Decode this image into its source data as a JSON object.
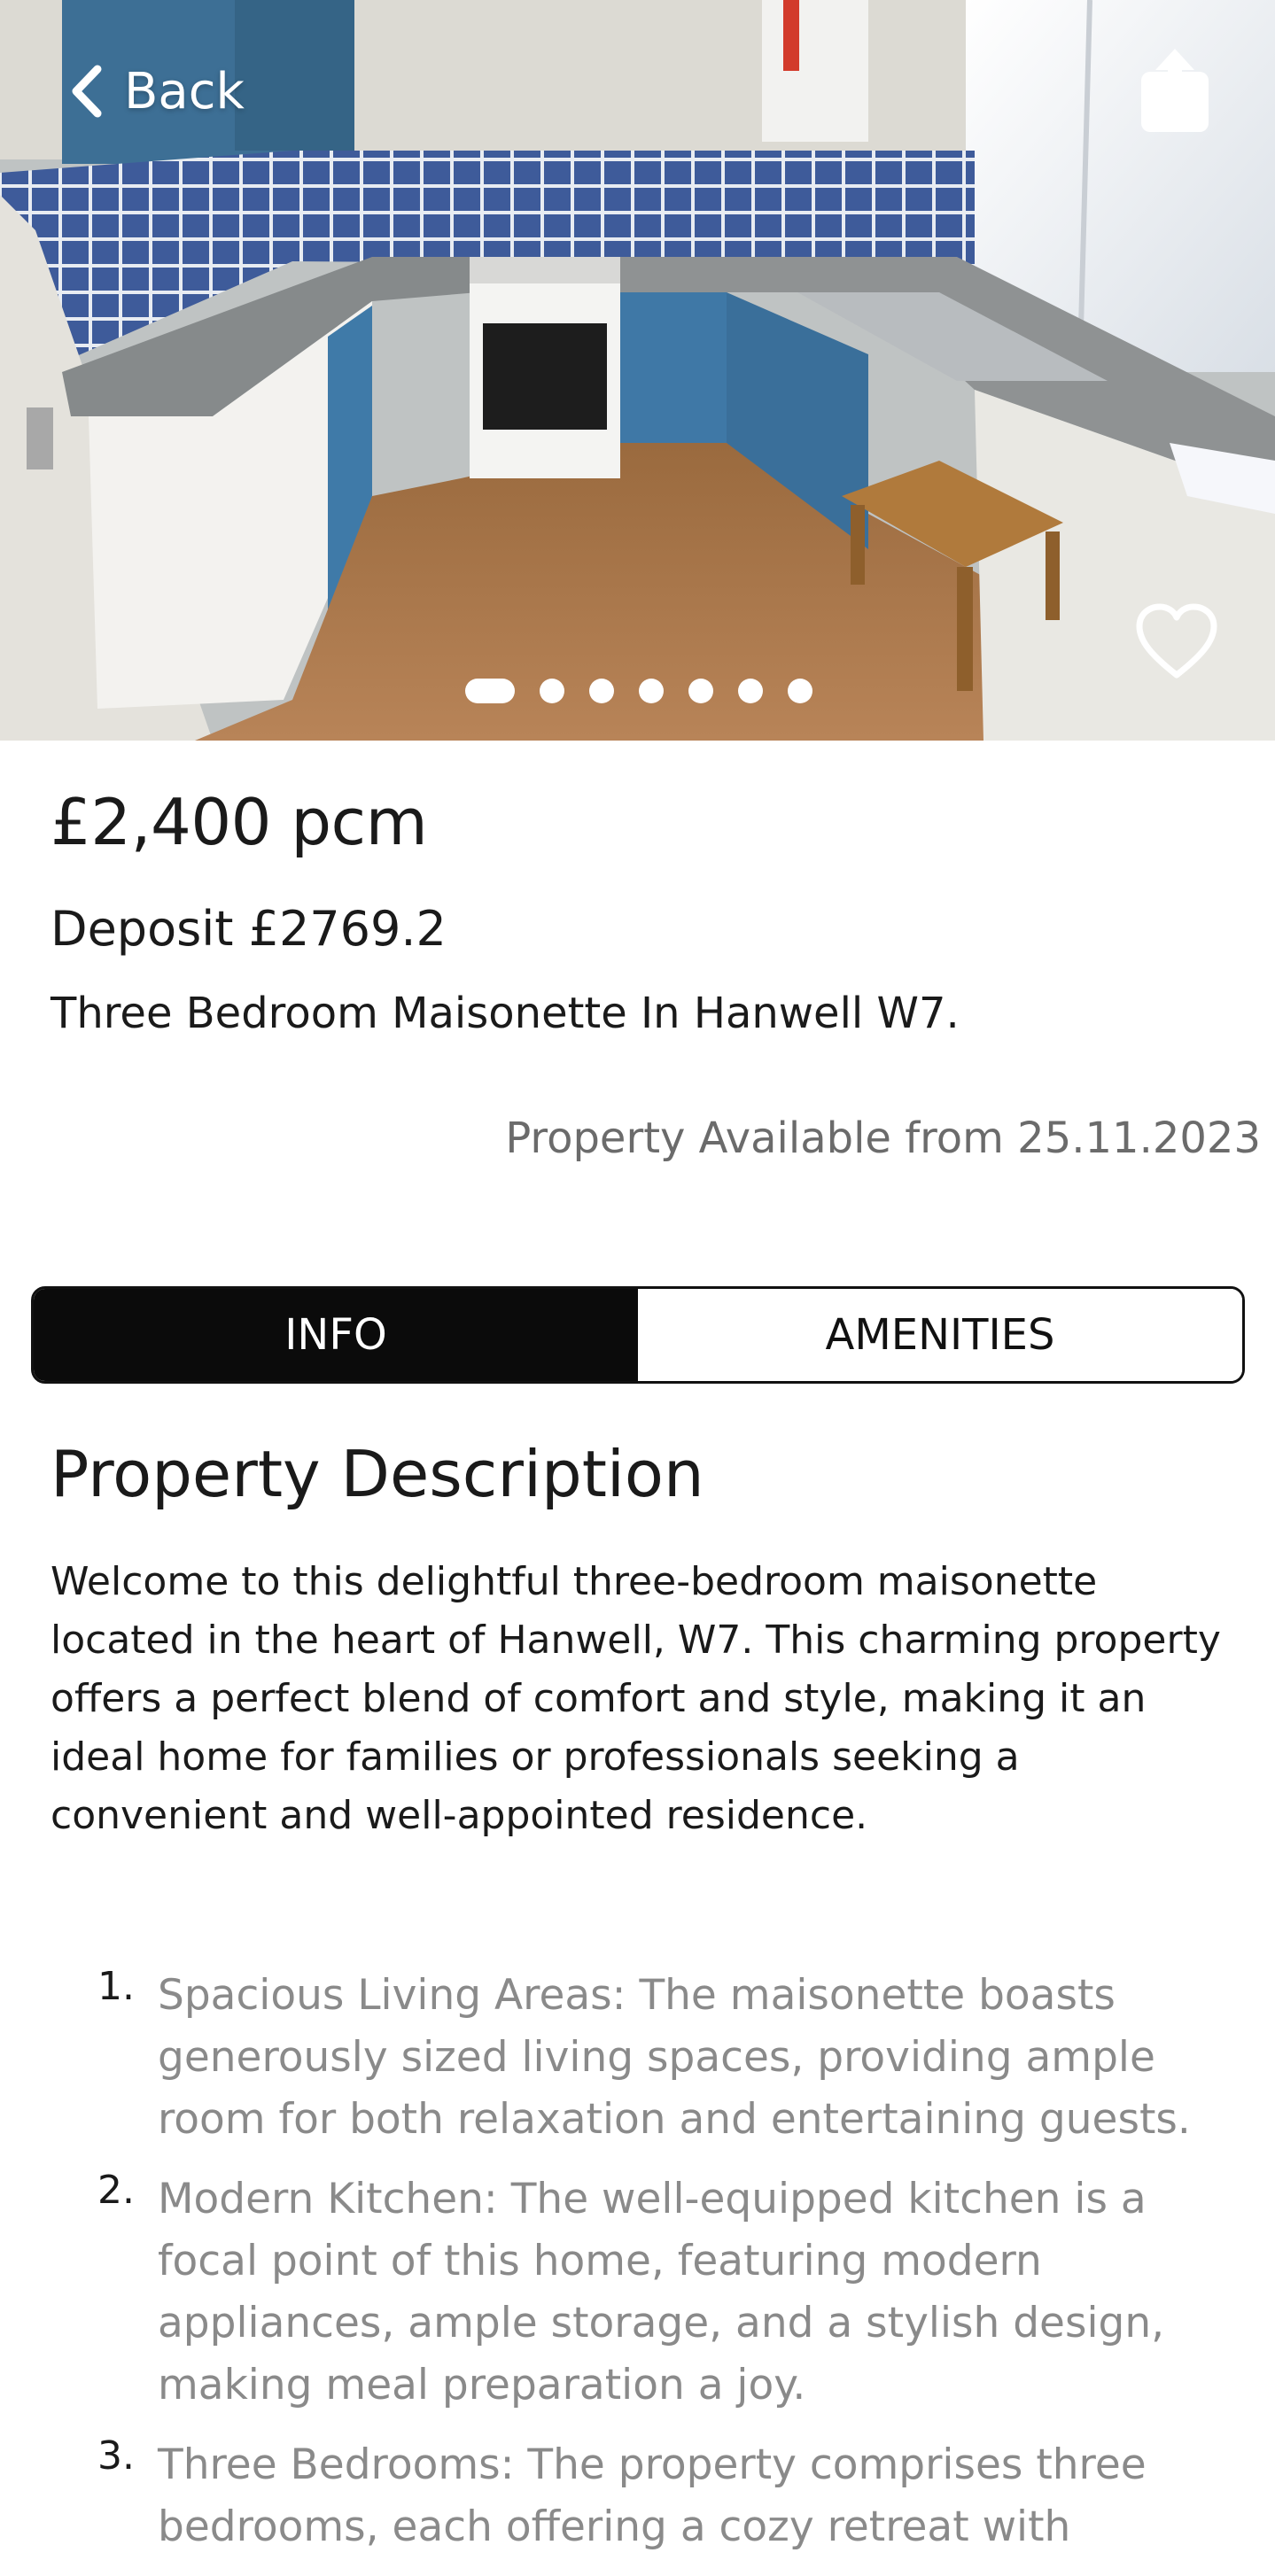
{
  "hero": {
    "back_label": "Back",
    "back_icon": "chevron-left-icon",
    "share_icon": "share-icon",
    "favorite_icon": "heart-outline-icon",
    "photo_count": 7,
    "active_photo_index": 0
  },
  "listing": {
    "price": "£2,400 pcm",
    "deposit": "Deposit £2769.2",
    "title": "Three Bedroom Maisonette In Hanwell W7.",
    "availability": "Property Available from 25.11.2023"
  },
  "tabs": [
    {
      "label": "INFO",
      "active": true
    },
    {
      "label": "AMENITIES",
      "active": false
    }
  ],
  "description": {
    "heading": "Property Description",
    "body": "Welcome to this delightful three-bedroom maisonette located in the heart of Hanwell, W7. This charming property offers a perfect blend of comfort and style, making it an ideal home for families or professionals seeking a convenient and well-appointed residence.",
    "features": [
      {
        "number": "1.",
        "text": "Spacious Living Areas: The maisonette boasts generously sized living spaces, providing ample room for both relaxation and entertaining guests."
      },
      {
        "number": "2.",
        "text": "Modern Kitchen: The well-equipped kitchen is a focal point of this home, featuring modern appliances, ample storage, and a stylish design, making meal preparation a joy."
      },
      {
        "number": "3.",
        "text": "Three Bedrooms: The property comprises three bedrooms, each offering a cozy retreat with"
      }
    ]
  },
  "colors": {
    "tab_active_bg": "#0b0b0b",
    "availability_text": "#6b6b6b",
    "feature_text": "#8a8a8a"
  }
}
